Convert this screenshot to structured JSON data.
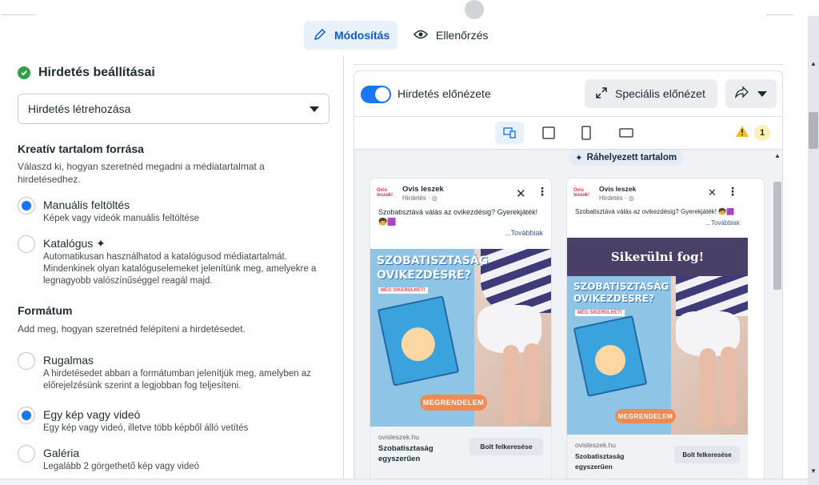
{
  "tabs": {
    "edit": "Módosítás",
    "review": "Ellenőrzés"
  },
  "left": {
    "title": "Hirdetés beállításai",
    "select_value": "Hirdetés létrehozása",
    "creative_source": {
      "heading": "Kreatív tartalom forrása",
      "desc": "Válaszd ki, hogyan szeretnéd megadni a médiatartalmat a hirdetésedhez.",
      "options": [
        {
          "label": "Manuális feltöltés",
          "sub": "Képek vagy videók manuális feltöltése",
          "selected": true
        },
        {
          "label": "Katalógus",
          "sub": "Automatikusan használhatod a katalógusod médiatartalmát. Mindenkinek olyan katalóguselemeket jelenítünk meg, amelyekre a legnagyobb valószínűséggel reagál majd.",
          "selected": false
        }
      ]
    },
    "format": {
      "heading": "Formátum",
      "desc": "Add meg, hogyan szeretnéd felépíteni a hirdetésedet.",
      "options": [
        {
          "label": "Rugalmas",
          "sub": "A hirdetésedet abban a formátumban jelenítjük meg, amelyben az előrejelzésünk szerint a legjobban fog teljesíteni.",
          "selected": false
        },
        {
          "label": "Egy kép vagy videó",
          "sub": "Egy kép vagy videó, illetve több képből álló vetítés",
          "selected": true
        },
        {
          "label": "Galéria",
          "sub": "Legalább 2 görgethető kép vagy videó",
          "selected": false
        }
      ]
    }
  },
  "preview": {
    "toggle_label": "Hirdetés előnézete",
    "special_label": "Speciális előnézet",
    "warning_count": "1",
    "placed_label": "Ráhelyezett tartalom",
    "ads": [
      {
        "name": "Ovis leszek",
        "sub": "Hirdetés · ◎",
        "text": "Szobatisztává válás az ovikezdésig? Gyerekjáték! 🧒🟪",
        "more": "...Továbbiak",
        "creative_title": "SZOBATISZTASÁG OVIKEZDÉSRE?",
        "creative_sub": "MÉG SIKERÜLHET!",
        "order_label": "MEGRENDELEM",
        "url": "ovisleszek.hu",
        "foot_title": "Szobatisztaság egyszerűen",
        "cta": "Bolt felkeresése",
        "logo": "Ovis leszek!"
      },
      {
        "name": "Ovis leszek",
        "sub": "Hirdetés · ◎",
        "text": "Szobatisztává válás az ovikezdésig? Gyerekjáték! 🧒🟪",
        "more": "...Továbbiak",
        "banner": "Sikerülni fog!",
        "creative_title": "SZOBATISZTASÁG OVIKEZDÉSRE?",
        "creative_sub": "MÉG SIKERÜLHET!",
        "order_label": "MEGRENDELEM",
        "url": "ovisleszek.hu",
        "foot_title": "Szobatisztaság egyszerűen",
        "cta": "Bolt felkeresése",
        "logo": "Ovis leszek!"
      }
    ]
  }
}
